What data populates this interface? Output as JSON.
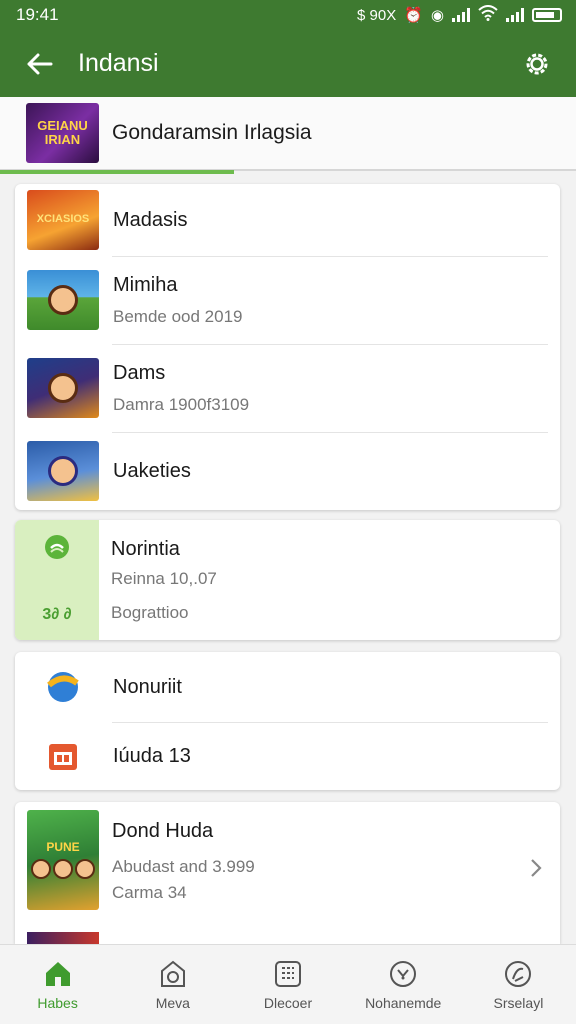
{
  "status": {
    "time": "19:41",
    "indicators": "$ 90X"
  },
  "appbar": {
    "title": "Indansi",
    "back_icon": "arrow-back-icon",
    "settings_icon": "gear-icon"
  },
  "header": {
    "title": "Gondaramsin Irlagsia",
    "thumb_text": "GEIANU IRIAN"
  },
  "card1": [
    {
      "title": "Madasis",
      "thumb_text": "XCIASIOS"
    },
    {
      "title": "Mimiha",
      "subtitle": "Bemde ood 2019"
    },
    {
      "title": "Dams",
      "subtitle": "Damra 1900f3109"
    },
    {
      "title": "Uaketies"
    }
  ],
  "card2": {
    "title": "Norintia",
    "subtitle1": "Reinna 10,.07",
    "subtitle2": "Bograttioo",
    "badge_text": "3∂ ∂"
  },
  "card3": [
    {
      "title": "Nonuriit",
      "icon": "sphere-icon"
    },
    {
      "title": "Iúuda 13",
      "icon": "calendar-icon"
    }
  ],
  "card4": {
    "title": "Dond Huda",
    "subtitle1": "Abudast and 3.999",
    "subtitle2": "Carma 34",
    "thumb_text": "PUNE"
  },
  "nav": [
    {
      "label": "Habes",
      "icon": "home-icon",
      "active": true
    },
    {
      "label": "Meva",
      "icon": "bag-icon",
      "active": false
    },
    {
      "label": "Dlecoer",
      "icon": "grid-icon",
      "active": false
    },
    {
      "label": "Nohanemde",
      "icon": "compass-icon",
      "active": false
    },
    {
      "label": "Srselayl",
      "icon": "profile-icon",
      "active": false
    }
  ],
  "colors": {
    "primary": "#3e7a30",
    "accent": "#3f9b2e",
    "progress": "#6dbb4d"
  }
}
